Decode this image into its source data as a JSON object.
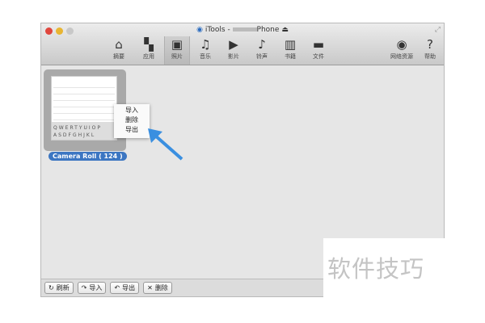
{
  "window": {
    "title_prefix": "iTools - ",
    "title_suffix": "Phone"
  },
  "toolbar": [
    {
      "label": "摘要",
      "icon": "home-icon",
      "glyph": "⌂"
    },
    {
      "label": "应用",
      "icon": "apps-icon",
      "glyph": "▚"
    },
    {
      "label": "照片",
      "icon": "photo-icon",
      "glyph": "▣"
    },
    {
      "label": "音乐",
      "icon": "music-icon",
      "glyph": "♫"
    },
    {
      "label": "影片",
      "icon": "play-icon",
      "glyph": "▶"
    },
    {
      "label": "铃声",
      "icon": "bell-icon",
      "glyph": "♪"
    },
    {
      "label": "书籍",
      "icon": "book-icon",
      "glyph": "▥"
    },
    {
      "label": "文件",
      "icon": "folder-icon",
      "glyph": "▬"
    },
    {
      "label": "网络资源",
      "icon": "globe-icon",
      "glyph": "◉"
    },
    {
      "label": "帮助",
      "icon": "help-icon",
      "glyph": "?"
    }
  ],
  "album": {
    "label": "Camera Roll ( 124 )",
    "keyboard_row1": "QWERTYUIOP",
    "keyboard_row2": "ASDFGHJKL"
  },
  "context_menu": [
    "导入",
    "删除",
    "导出"
  ],
  "bottom": [
    {
      "label": "刷新",
      "glyph": "↻"
    },
    {
      "label": "导入",
      "glyph": "↷"
    },
    {
      "label": "导出",
      "glyph": "↶"
    },
    {
      "label": "删除",
      "glyph": "✕"
    }
  ],
  "watermark": "软件技巧"
}
